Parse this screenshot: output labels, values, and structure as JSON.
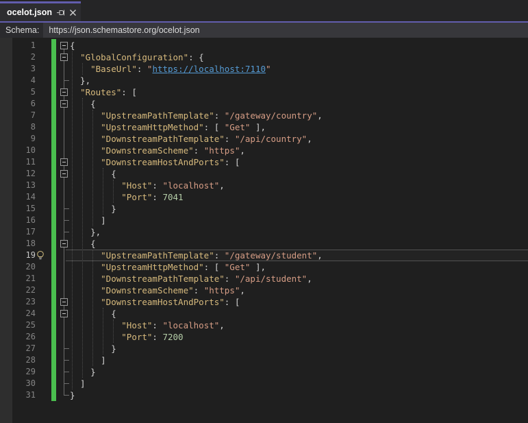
{
  "tab": {
    "label": "ocelot.json",
    "pin_icon": "pin-icon",
    "close_icon": "close-icon"
  },
  "schema_bar": {
    "label": "Schema:",
    "url": "https://json.schemastore.org/ocelot.json"
  },
  "colors": {
    "accent_purple": "#625dae",
    "editor_bg": "#1f1f1f",
    "tab_bg": "#2d2d30",
    "tabstrip_bg": "#252526",
    "schema_bar_bg": "#2a2a2d",
    "schema_combo_bg": "#37373b",
    "gutter_margin_bg": "#2e2e2e",
    "change_bar_green": "#4abf4f",
    "key_color": "#d7ba7d",
    "string_color": "#d69d85",
    "number_color": "#b5cea8",
    "punct_color": "#d4d4d4",
    "link_color": "#569cd6",
    "line_number_color": "#858585",
    "current_line_number_color": "#c8c8c8"
  },
  "editor": {
    "current_line": 19,
    "lightbulb_line": 19,
    "fold_box_lines": [
      1,
      2,
      5,
      6,
      11,
      12,
      18,
      23,
      24
    ],
    "fold_end_lines": [
      4,
      15,
      16,
      17,
      27,
      28,
      29,
      30,
      31
    ],
    "indent_guides": [
      {
        "col": 0,
        "from": 2,
        "to": 30
      },
      {
        "col": 2,
        "from": 3,
        "to": 3
      },
      {
        "col": 2,
        "from": 6,
        "to": 29
      },
      {
        "col": 4,
        "from": 7,
        "to": 16
      },
      {
        "col": 4,
        "from": 19,
        "to": 28
      },
      {
        "col": 6,
        "from": 12,
        "to": 15
      },
      {
        "col": 6,
        "from": 24,
        "to": 27
      },
      {
        "col": 8,
        "from": 13,
        "to": 14
      },
      {
        "col": 8,
        "from": 25,
        "to": 26
      }
    ],
    "lines": [
      {
        "n": 1,
        "tokens": [
          [
            "{",
            "punct"
          ]
        ]
      },
      {
        "n": 2,
        "tokens": [
          [
            "  ",
            "ws"
          ],
          [
            "\"GlobalConfiguration\"",
            "key"
          ],
          [
            ": {",
            "punct"
          ]
        ]
      },
      {
        "n": 3,
        "tokens": [
          [
            "    ",
            "ws"
          ],
          [
            "\"BaseUrl\"",
            "key"
          ],
          [
            ": ",
            "punct"
          ],
          [
            "\"",
            "str"
          ],
          [
            "https://localhost:7110",
            "link"
          ],
          [
            "\"",
            "str"
          ]
        ]
      },
      {
        "n": 4,
        "tokens": [
          [
            "  },",
            "punct"
          ]
        ]
      },
      {
        "n": 5,
        "tokens": [
          [
            "  ",
            "ws"
          ],
          [
            "\"Routes\"",
            "key"
          ],
          [
            ": [",
            "punct"
          ]
        ]
      },
      {
        "n": 6,
        "tokens": [
          [
            "    {",
            "punct"
          ]
        ]
      },
      {
        "n": 7,
        "tokens": [
          [
            "      ",
            "ws"
          ],
          [
            "\"UpstreamPathTemplate\"",
            "key"
          ],
          [
            ": ",
            "punct"
          ],
          [
            "\"/gateway/country\"",
            "str"
          ],
          [
            ",",
            "punct"
          ]
        ]
      },
      {
        "n": 8,
        "tokens": [
          [
            "      ",
            "ws"
          ],
          [
            "\"UpstreamHttpMethod\"",
            "key"
          ],
          [
            ": [ ",
            "punct"
          ],
          [
            "\"Get\"",
            "str"
          ],
          [
            " ],",
            "punct"
          ]
        ]
      },
      {
        "n": 9,
        "tokens": [
          [
            "      ",
            "ws"
          ],
          [
            "\"DownstreamPathTemplate\"",
            "key"
          ],
          [
            ": ",
            "punct"
          ],
          [
            "\"/api/country\"",
            "str"
          ],
          [
            ",",
            "punct"
          ]
        ]
      },
      {
        "n": 10,
        "tokens": [
          [
            "      ",
            "ws"
          ],
          [
            "\"DownstreamScheme\"",
            "key"
          ],
          [
            ": ",
            "punct"
          ],
          [
            "\"https\"",
            "str"
          ],
          [
            ",",
            "punct"
          ]
        ]
      },
      {
        "n": 11,
        "tokens": [
          [
            "      ",
            "ws"
          ],
          [
            "\"DownstreamHostAndPorts\"",
            "key"
          ],
          [
            ": [",
            "punct"
          ]
        ]
      },
      {
        "n": 12,
        "tokens": [
          [
            "        {",
            "punct"
          ]
        ]
      },
      {
        "n": 13,
        "tokens": [
          [
            "          ",
            "ws"
          ],
          [
            "\"Host\"",
            "key"
          ],
          [
            ": ",
            "punct"
          ],
          [
            "\"localhost\"",
            "str"
          ],
          [
            ",",
            "punct"
          ]
        ]
      },
      {
        "n": 14,
        "tokens": [
          [
            "          ",
            "ws"
          ],
          [
            "\"Port\"",
            "key"
          ],
          [
            ": ",
            "punct"
          ],
          [
            "7041",
            "num"
          ]
        ]
      },
      {
        "n": 15,
        "tokens": [
          [
            "        }",
            "punct"
          ]
        ]
      },
      {
        "n": 16,
        "tokens": [
          [
            "      ]",
            "punct"
          ]
        ]
      },
      {
        "n": 17,
        "tokens": [
          [
            "    },",
            "punct"
          ]
        ]
      },
      {
        "n": 18,
        "tokens": [
          [
            "    {",
            "punct"
          ]
        ]
      },
      {
        "n": 19,
        "tokens": [
          [
            "      ",
            "ws"
          ],
          [
            "\"UpstreamPathTemplate\"",
            "key"
          ],
          [
            ": ",
            "punct"
          ],
          [
            "\"/gateway/student\"",
            "str"
          ],
          [
            ",",
            "punct"
          ]
        ]
      },
      {
        "n": 20,
        "tokens": [
          [
            "      ",
            "ws"
          ],
          [
            "\"UpstreamHttpMethod\"",
            "key"
          ],
          [
            ": [ ",
            "punct"
          ],
          [
            "\"Get\"",
            "str"
          ],
          [
            " ],",
            "punct"
          ]
        ]
      },
      {
        "n": 21,
        "tokens": [
          [
            "      ",
            "ws"
          ],
          [
            "\"DownstreamPathTemplate\"",
            "key"
          ],
          [
            ": ",
            "punct"
          ],
          [
            "\"/api/student\"",
            "str"
          ],
          [
            ",",
            "punct"
          ]
        ]
      },
      {
        "n": 22,
        "tokens": [
          [
            "      ",
            "ws"
          ],
          [
            "\"DownstreamScheme\"",
            "key"
          ],
          [
            ": ",
            "punct"
          ],
          [
            "\"https\"",
            "str"
          ],
          [
            ",",
            "punct"
          ]
        ]
      },
      {
        "n": 23,
        "tokens": [
          [
            "      ",
            "ws"
          ],
          [
            "\"DownstreamHostAndPorts\"",
            "key"
          ],
          [
            ": [",
            "punct"
          ]
        ]
      },
      {
        "n": 24,
        "tokens": [
          [
            "        {",
            "punct"
          ]
        ]
      },
      {
        "n": 25,
        "tokens": [
          [
            "          ",
            "ws"
          ],
          [
            "\"Host\"",
            "key"
          ],
          [
            ": ",
            "punct"
          ],
          [
            "\"localhost\"",
            "str"
          ],
          [
            ",",
            "punct"
          ]
        ]
      },
      {
        "n": 26,
        "tokens": [
          [
            "          ",
            "ws"
          ],
          [
            "\"Port\"",
            "key"
          ],
          [
            ": ",
            "punct"
          ],
          [
            "7200",
            "num"
          ]
        ]
      },
      {
        "n": 27,
        "tokens": [
          [
            "        }",
            "punct"
          ]
        ]
      },
      {
        "n": 28,
        "tokens": [
          [
            "      ]",
            "punct"
          ]
        ]
      },
      {
        "n": 29,
        "tokens": [
          [
            "    }",
            "punct"
          ]
        ]
      },
      {
        "n": 30,
        "tokens": [
          [
            "  ]",
            "punct"
          ]
        ]
      },
      {
        "n": 31,
        "tokens": [
          [
            "}",
            "punct"
          ]
        ]
      }
    ]
  }
}
